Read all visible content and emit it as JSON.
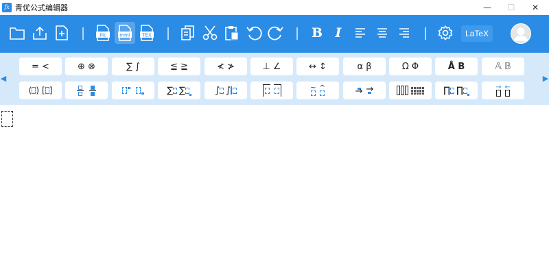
{
  "window": {
    "title": "青优公式编辑器",
    "logo_text": "fx",
    "minimize": "—",
    "maximize": "☐",
    "close": "✕"
  },
  "toolbar": {
    "bold": "B",
    "italic": "I",
    "latex": "LaTeX",
    "file_labels": {
      "pic": "Pic",
      "mml": "mml",
      "tex": "TEX"
    }
  },
  "palette": {
    "row1": [
      "= <",
      "⊕ ⊗",
      "∑ ∫",
      "≦ ≧",
      "≮ ≯",
      "⊥ ∠",
      "↔ ↕",
      "α β",
      "Ω Φ",
      "Å B",
      "𝔸 𝔹"
    ],
    "row2_names": [
      "fence-templates",
      "fraction-templates",
      "script-templates",
      "summation-templates",
      "integral-templates",
      "bar-templates",
      "accent-templates",
      "arrow-label-templates",
      "matrix-templates",
      "product-templates",
      "vector-templates"
    ]
  },
  "colors": {
    "primary": "#2b8ce6",
    "palette_bg": "#d6e9fb"
  }
}
